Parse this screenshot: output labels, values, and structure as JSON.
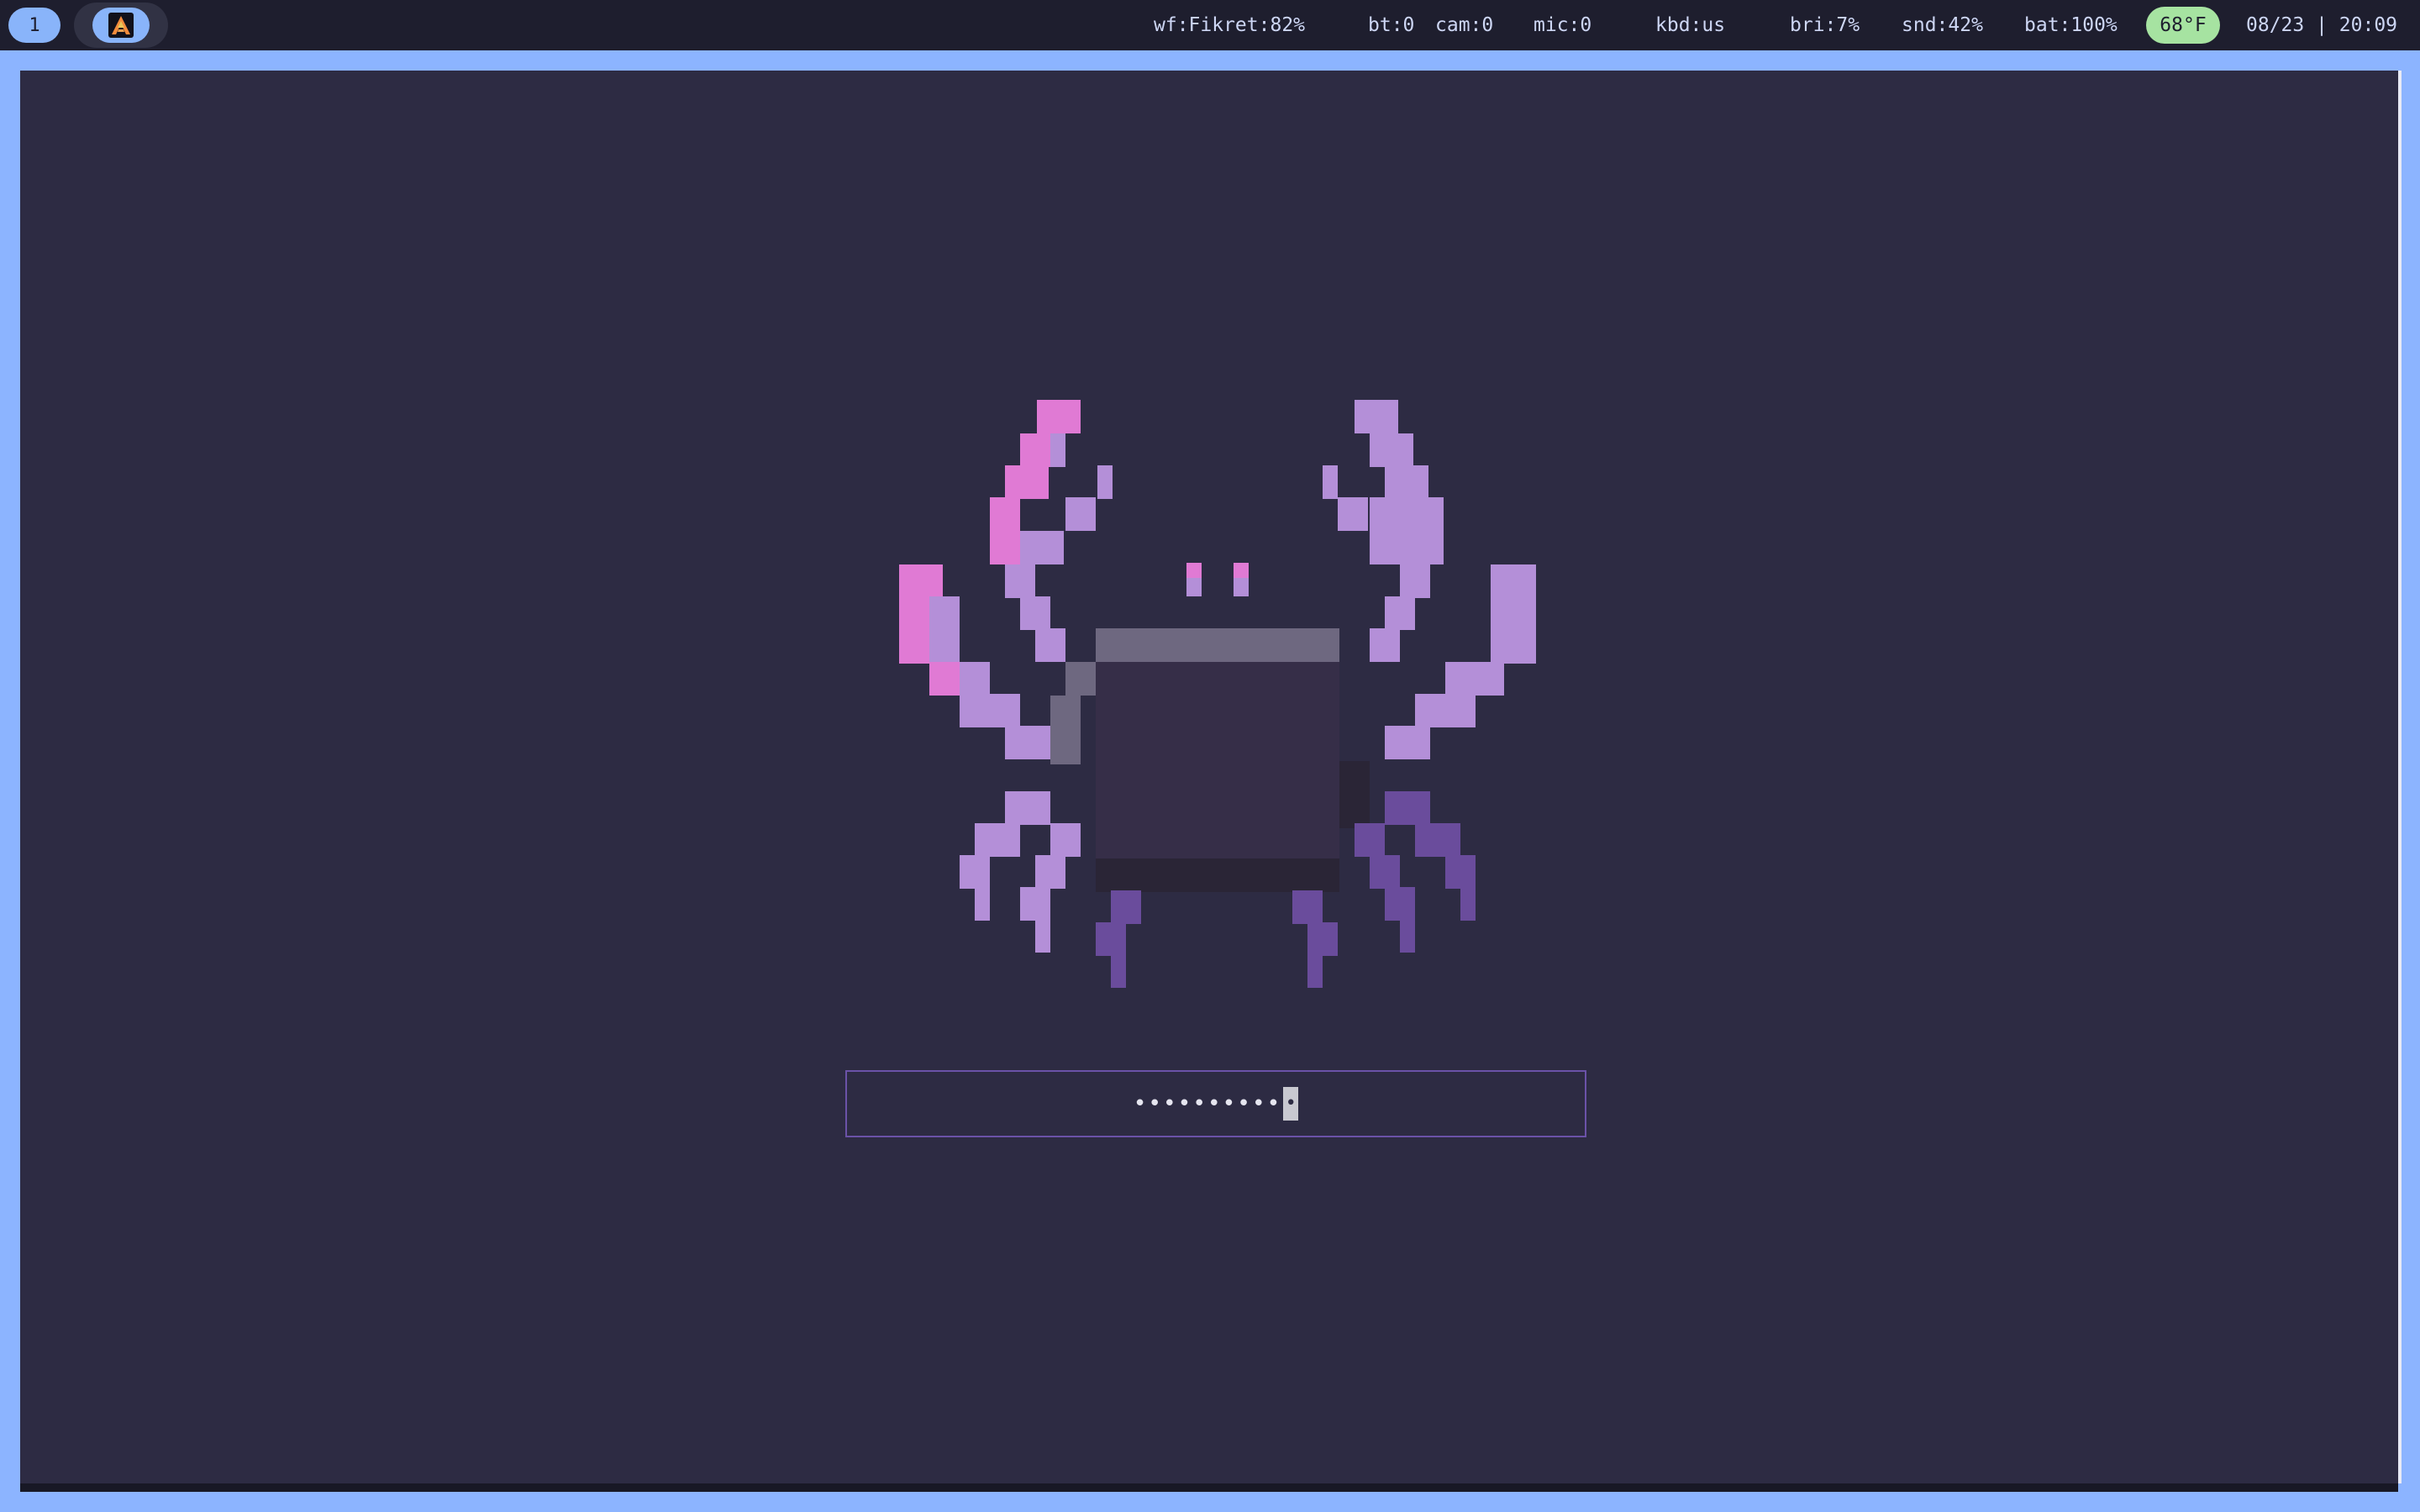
{
  "topbar": {
    "workspace": "1",
    "app_icon": "alacritty-icon",
    "wifi": "wf:Fikret:82%",
    "bluetooth": "bt:0",
    "camera": "cam:0",
    "mic": "mic:0",
    "keyboard": "kbd:us",
    "brightness": "bri:7%",
    "sound": "snd:42%",
    "battery": "bat:100%",
    "temperature": "68°F",
    "datetime": "08/23 | 20:09"
  },
  "lockscreen": {
    "password_mask": "••••••••••",
    "cursor_char": "•",
    "art": "crab-pixel-art"
  },
  "colors": {
    "bar_bg": "#1e1e2e",
    "border": "#8cb4ff",
    "background": "#2d2b43",
    "accent_pink": "#e07ad4",
    "accent_lilac": "#b48fd8",
    "accent_purple": "#6a4c9c",
    "temp_green": "#a6e3a1",
    "input_border": "#6b52a8"
  }
}
